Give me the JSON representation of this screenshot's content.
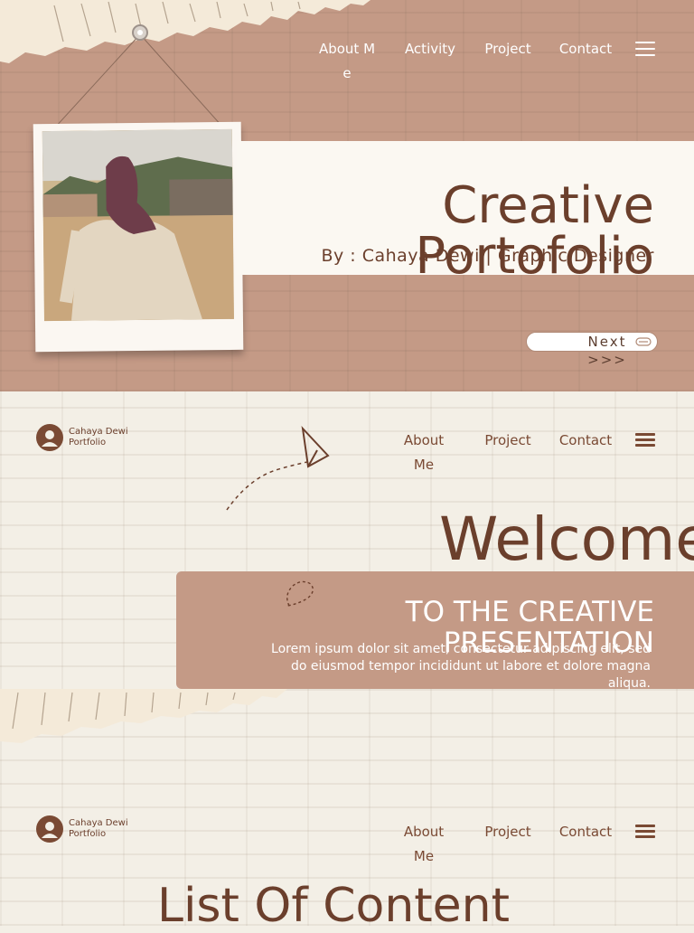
{
  "hero": {
    "nav": [
      "About Me",
      "Activity",
      "Project",
      "Contact"
    ],
    "title": "Creative Portofolio",
    "subtitle": "By : Cahaya Dewi | Graphic Designer",
    "next_label": "Next >>>"
  },
  "welcome_section": {
    "logo_line1": "Cahaya Dewi",
    "logo_line2": "Portfolio",
    "nav": [
      "About Me",
      "Project",
      "Contact"
    ],
    "title": "Welcome",
    "subtitle": "TO THE CREATIVE PRESENTATION",
    "body": "Lorem ipsum dolor sit amet, consectetur adipiscing elit, sed do eiusmod tempor incididunt ut labore et dolore magna aliqua."
  },
  "content_section": {
    "logo_line1": "Cahaya Dewi",
    "logo_line2": "Portfolio",
    "nav": [
      "About Me",
      "Project",
      "Contact"
    ],
    "title": "List Of Content"
  },
  "colors": {
    "brand_brown": "#6b3f2c",
    "terracotta": "#c49a86",
    "cream": "#fbf8f2"
  },
  "icons": [
    "hamburger-menu-icon",
    "user-avatar-icon",
    "arrow-icon",
    "paper-plane-icon"
  ]
}
